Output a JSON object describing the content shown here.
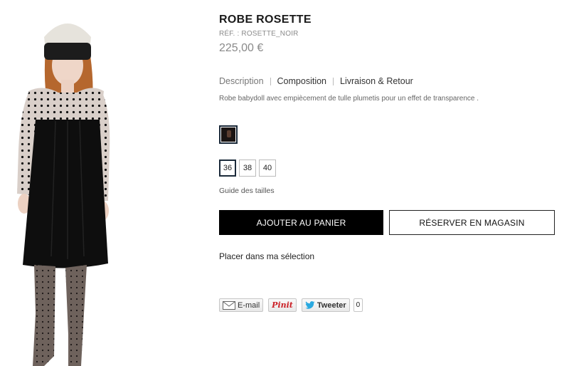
{
  "product": {
    "title": "ROBE ROSETTE",
    "reference": "RÉF. : ROSETTE_NOIR",
    "price": "225,00 €",
    "image_alt": "model-wearing-black-babydoll-dress"
  },
  "tabs": [
    {
      "label": "Description",
      "active": false
    },
    {
      "label": "Composition",
      "active": true
    },
    {
      "label": "Livraison & Retour",
      "active": true
    }
  ],
  "description": "Robe babydoll avec empiècement de tulle plumetis pour un effet de transparence .",
  "colors": [
    {
      "name": "noir",
      "hex": "#1a1413",
      "selected": true
    }
  ],
  "sizes": [
    {
      "label": "36",
      "selected": true
    },
    {
      "label": "38",
      "selected": false
    },
    {
      "label": "40",
      "selected": false
    }
  ],
  "size_guide_label": "Guide des tailles",
  "buttons": {
    "add_to_cart": "AJOUTER AU PANIER",
    "reserve_in_store": "RÉSERVER EN MAGASIN"
  },
  "selection_label": "Placer dans ma sélection",
  "social": {
    "email_label": "E-mail",
    "pin_label": "Pinit",
    "tweet_label": "Tweeter",
    "tweet_count": "0"
  },
  "theme": {
    "button_primary_bg": "#000000",
    "selected_border": "#1b2a3a",
    "pinterest_red": "#cb2027",
    "twitter_blue": "#2aa9e0"
  }
}
